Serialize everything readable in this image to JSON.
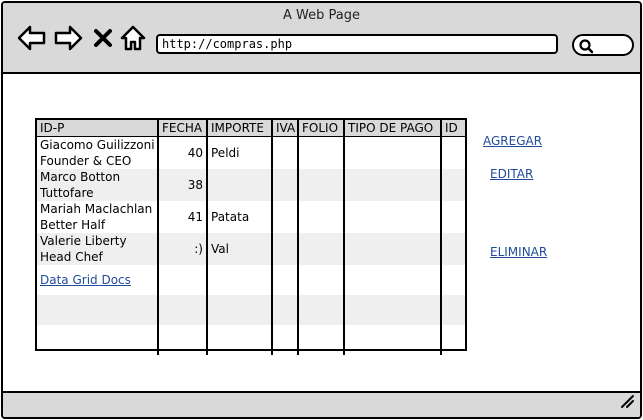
{
  "browser": {
    "title": "A Web Page",
    "url": "http://compras.php",
    "search_value": ""
  },
  "grid": {
    "columns": [
      "ID-P",
      "FECHA",
      "IMPORTE",
      "IVA",
      "FOLIO",
      "TIPO DE PAGO",
      "ID"
    ],
    "rows": [
      {
        "name": "Giacomo Guilizzoni",
        "role": "Founder & CEO",
        "fecha": "40",
        "importe": "Peldi"
      },
      {
        "name": "Marco Botton",
        "role": "Tuttofare",
        "fecha": "38",
        "importe": ""
      },
      {
        "name": "Mariah Maclachlan",
        "role": "Better Half",
        "fecha": "41",
        "importe": "Patata"
      },
      {
        "name": "Valerie Liberty",
        "role": "Head Chef",
        "fecha": ":)",
        "importe": "Val"
      }
    ],
    "docs_link": "Data Grid Docs"
  },
  "actions": {
    "agregar": "AGREGAR",
    "editar": "EDITAR",
    "eliminar": "ELIMINAR"
  },
  "icons": {
    "back": "arrow-left-icon",
    "forward": "arrow-right-icon",
    "close": "close-icon",
    "home": "home-icon",
    "search": "search-icon",
    "resize": "resize-grip-icon"
  }
}
